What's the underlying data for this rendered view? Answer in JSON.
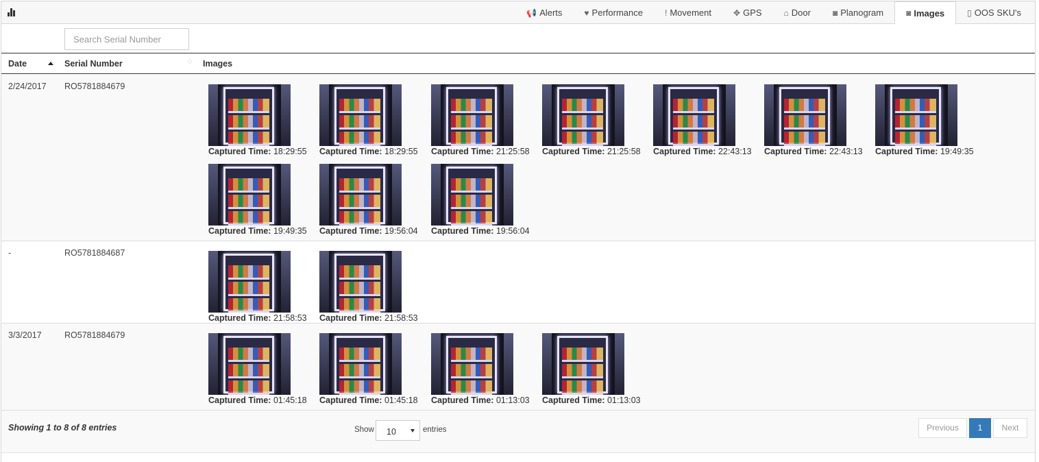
{
  "toolbar": {
    "chart_icon": "bar-chart-icon"
  },
  "tabs": [
    {
      "label": "Alerts",
      "icon": "bullhorn-icon",
      "glyph": "📢"
    },
    {
      "label": "Performance",
      "icon": "heart-icon",
      "glyph": "♥"
    },
    {
      "label": "Movement",
      "icon": "exclamation-icon",
      "glyph": "!"
    },
    {
      "label": "GPS",
      "icon": "move-icon",
      "glyph": "✥"
    },
    {
      "label": "Door",
      "icon": "home-icon",
      "glyph": "⌂"
    },
    {
      "label": "Planogram",
      "icon": "camera-icon",
      "glyph": "◙"
    },
    {
      "label": "Images",
      "icon": "camera-icon",
      "glyph": "◙",
      "active": true
    },
    {
      "label": "OOS SKU's",
      "icon": "fridge-icon",
      "glyph": "▯"
    }
  ],
  "search": {
    "placeholder": "Search Serial Number"
  },
  "table": {
    "headers": {
      "date": "Date",
      "serial": "Serial Number",
      "images": "Images"
    },
    "caption_label": "Captured Time:",
    "rows": [
      {
        "date": "2/24/2017",
        "serial": "RO5781884679",
        "images": [
          "18:29:55",
          "18:29:55",
          "21:25:58",
          "21:25:58",
          "22:43:13",
          "22:43:13",
          "19:49:35",
          "19:49:35",
          "19:56:04",
          "19:56:04"
        ]
      },
      {
        "date": "-",
        "serial": "RO5781884687",
        "images": [
          "21:58:53",
          "21:58:53"
        ]
      },
      {
        "date": "3/3/2017",
        "serial": "RO5781884679",
        "images": [
          "01:45:18",
          "01:45:18",
          "01:13:03",
          "01:13:03"
        ]
      }
    ]
  },
  "footer": {
    "info": "Showing 1 to 8 of 8 entries",
    "show_label": "Show",
    "page_size": "10",
    "entries_label": "entries",
    "previous": "Previous",
    "page": "1",
    "next": "Next"
  },
  "colors": {
    "accent": "#337ab7",
    "row_alt": "#f9f9f9"
  }
}
